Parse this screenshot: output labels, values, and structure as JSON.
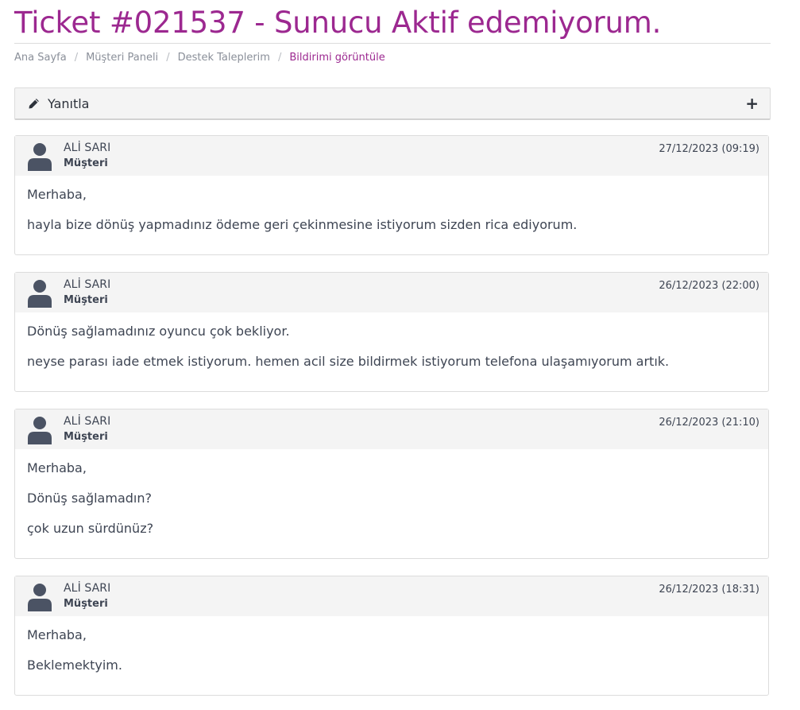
{
  "header": {
    "title": "Ticket #021537 - Sunucu Aktif edemiyorum."
  },
  "breadcrumb": {
    "items": [
      "Ana Sayfa",
      "Müşteri Paneli",
      "Destek Taleplerim"
    ],
    "active": "Bildirimi görüntüle",
    "separator": "/"
  },
  "reply": {
    "label": "Yanıtla",
    "expand_symbol": "+",
    "icon": "pencil-icon"
  },
  "colors": {
    "accent": "#9c2890",
    "text": "#3e4553",
    "panel_bg": "#f4f4f4",
    "avatar": "#4b5364"
  },
  "messages": [
    {
      "author": "ALİ SARI",
      "role": "Müşteri",
      "date": "27/12/2023 (09:19)",
      "lines": [
        "Merhaba,",
        "hayla bize dönüş yapmadınız ödeme geri çekinmesine istiyorum sizden rica ediyorum."
      ]
    },
    {
      "author": "ALİ SARI",
      "role": "Müşteri",
      "date": "26/12/2023 (22:00)",
      "lines": [
        "Dönüş sağlamadınız oyuncu çok bekliyor.",
        "neyse parası iade etmek istiyorum. hemen acil size bildirmek istiyorum telefona ulaşamıyorum artık."
      ]
    },
    {
      "author": "ALİ SARI",
      "role": "Müşteri",
      "date": "26/12/2023 (21:10)",
      "lines": [
        "Merhaba,",
        "Dönüş sağlamadın?",
        "çok uzun sürdünüz?"
      ]
    },
    {
      "author": "ALİ SARI",
      "role": "Müşteri",
      "date": "26/12/2023 (18:31)",
      "lines": [
        "Merhaba,",
        "Beklemektyim."
      ]
    }
  ]
}
